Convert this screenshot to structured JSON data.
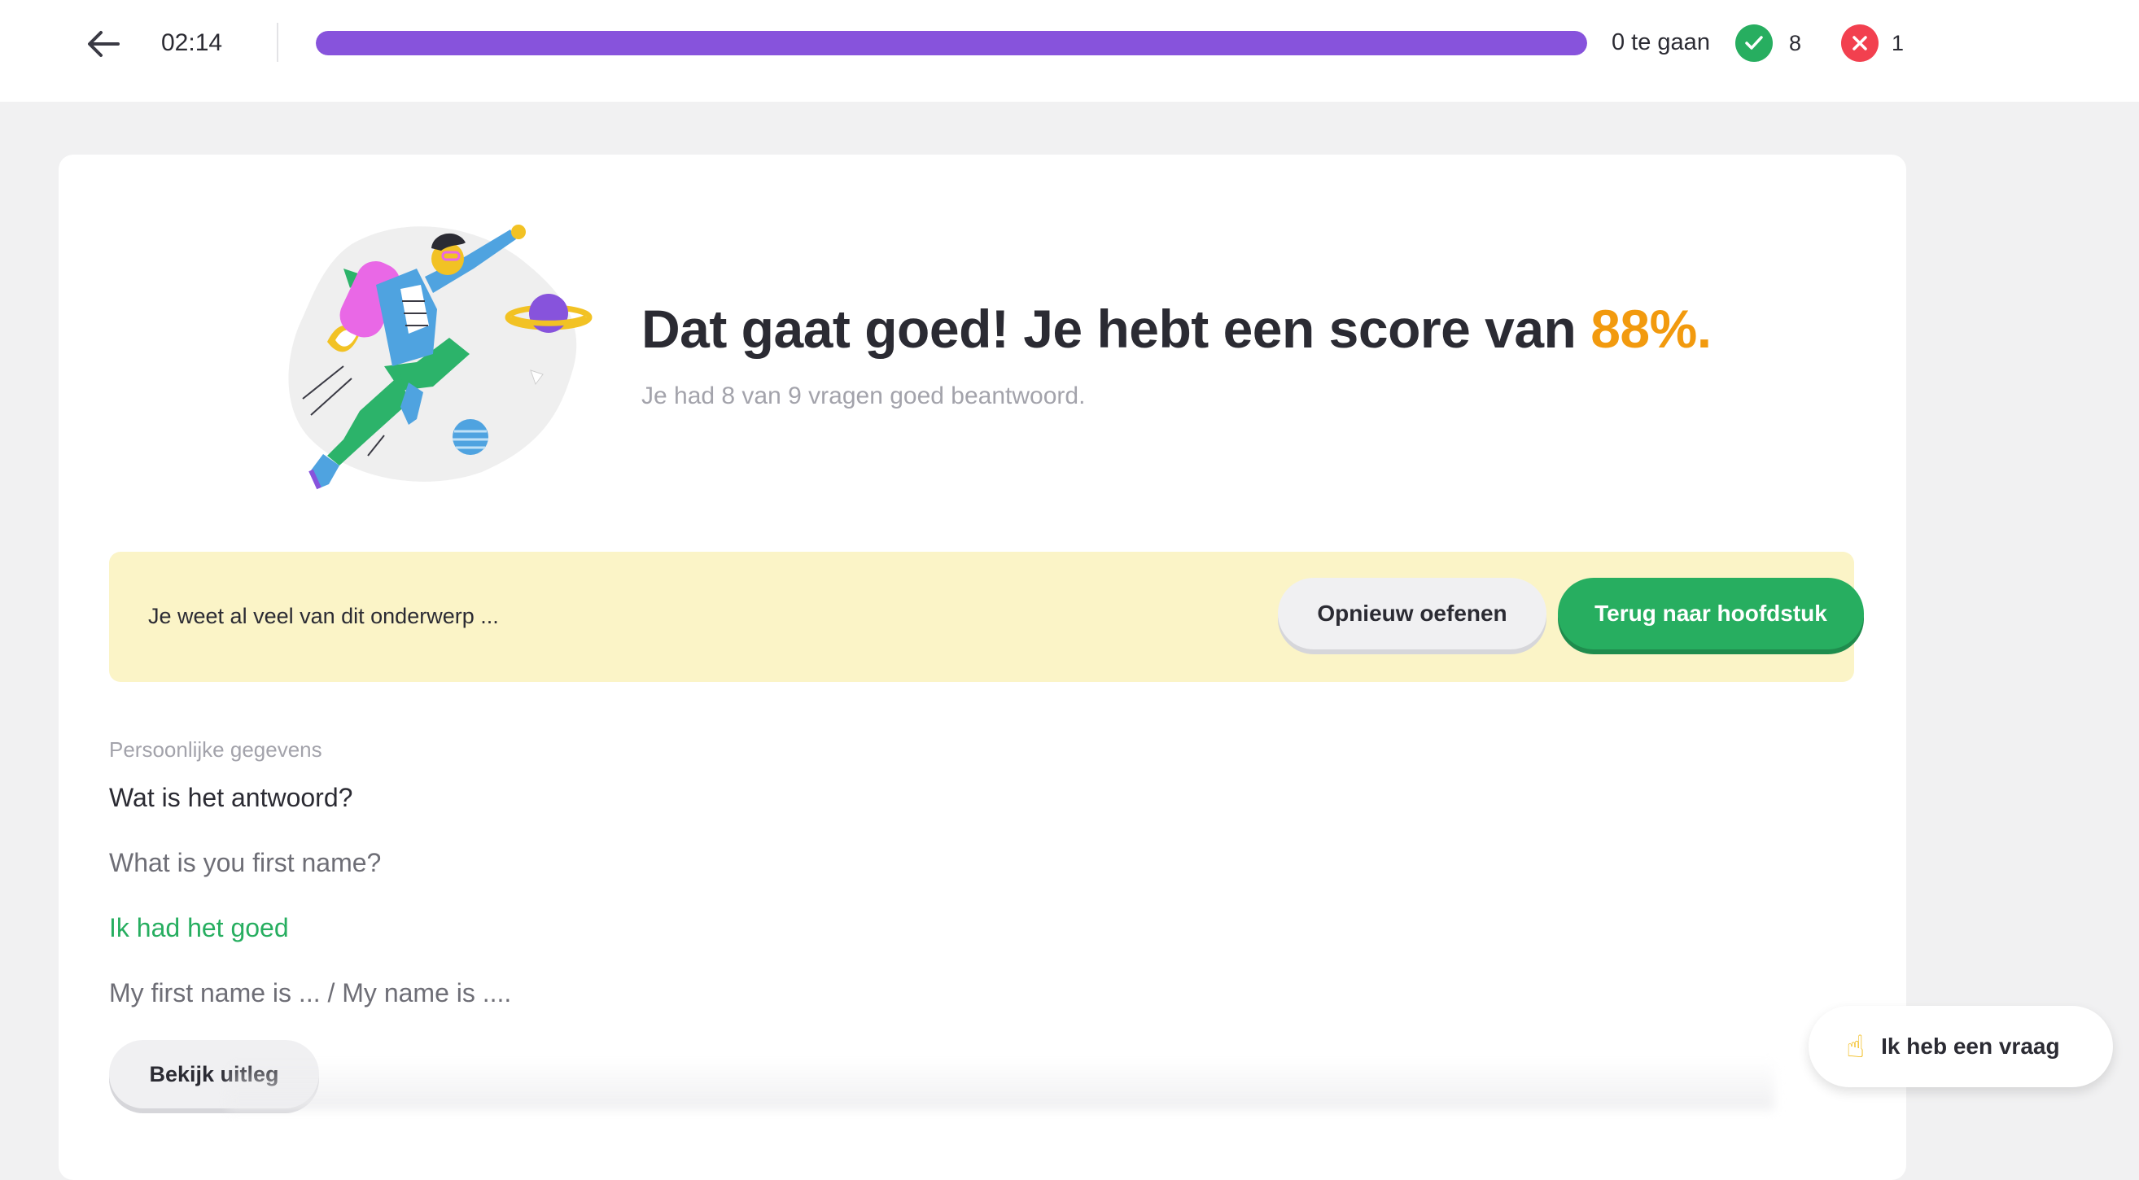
{
  "header": {
    "timer": "02:14",
    "progress_fraction": 1.0,
    "progress_color": "#8753dc",
    "remaining_label": "0 te gaan",
    "correct_count": "8",
    "wrong_count": "1",
    "back_icon": "arrow-left-icon",
    "correct_icon": "check-icon",
    "wrong_icon": "close-icon"
  },
  "result": {
    "headline_prefix": "Dat gaat goed! Je hebt een score van",
    "score": "88%.",
    "subline": "Je had 8 van 9 vragen goed beantwoord.",
    "accent_color": "#f29a0e"
  },
  "feedback": {
    "message": "Je weet al veel van dit onderwerp ...",
    "retry_label": "Opnieuw oefenen",
    "back_label": "Terug naar hoofdstuk"
  },
  "question": {
    "category": "Persoonlijke gegevens",
    "title": "Wat is het antwoord?",
    "text": "What is you first name?",
    "result": "Ik had het goed",
    "answer": "My first name is ... / My name is ....",
    "explain_label": "Bekijk uitleg"
  },
  "help": {
    "emoji": "☝",
    "label": "Ik heb een vraag"
  },
  "colors": {
    "success": "#27ae60",
    "error": "#f2404f",
    "feedback_bg": "#fbf4c7"
  }
}
